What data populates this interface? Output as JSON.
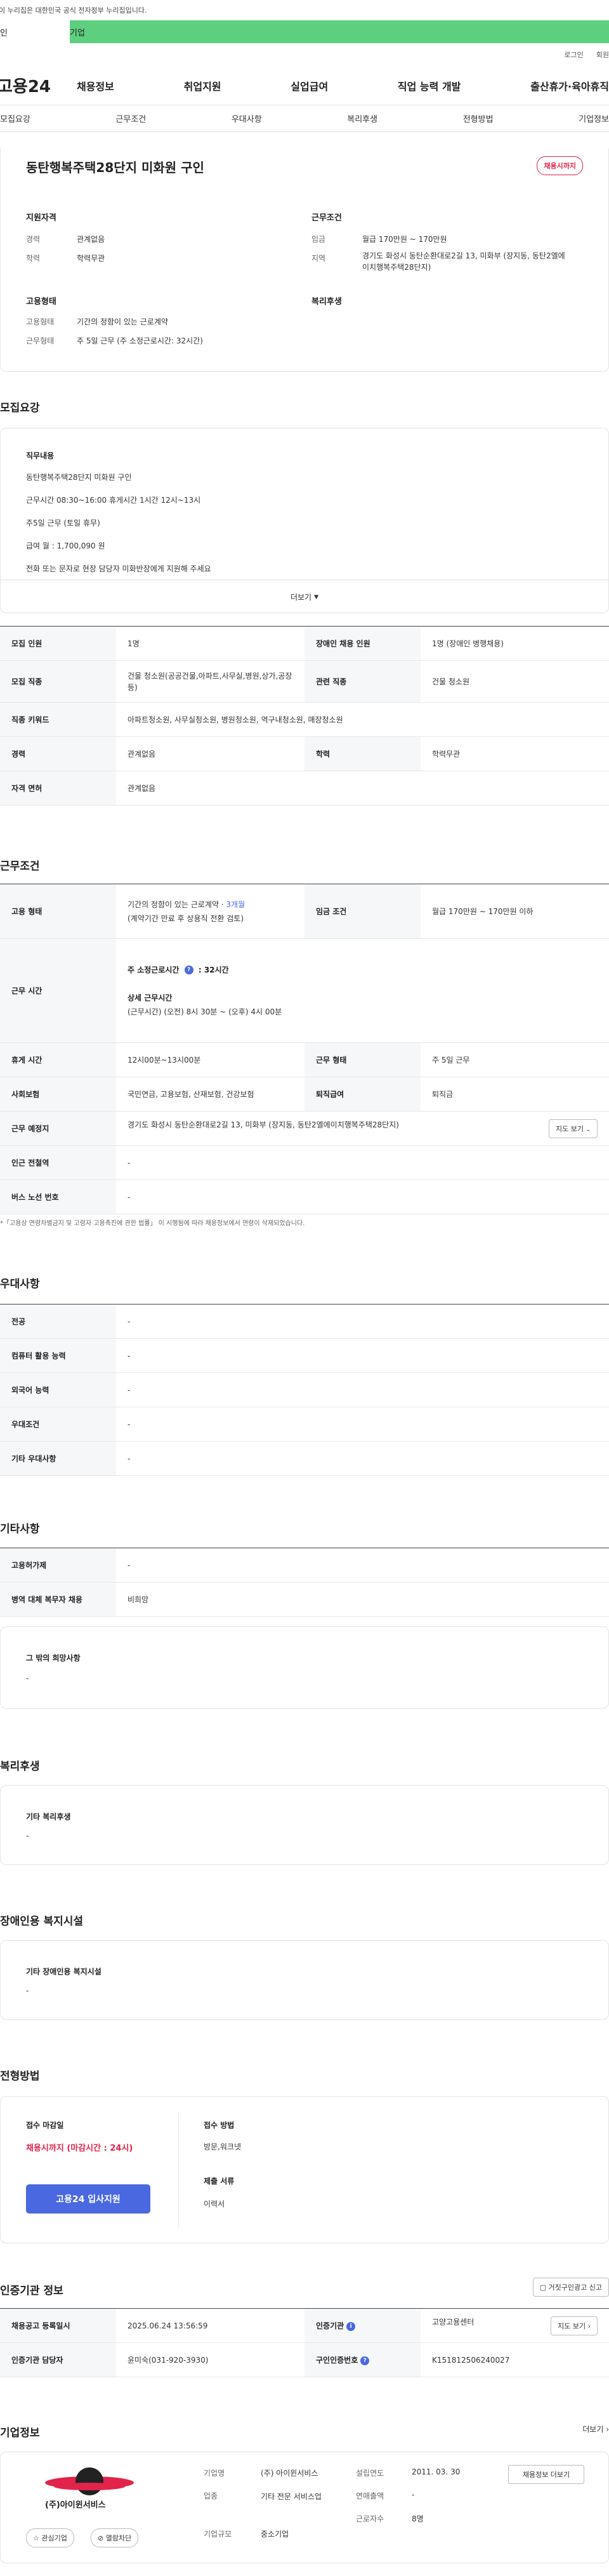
{
  "gov_banner": "이 누리집은 대한민국 공식 전자정부 누리집입니다.",
  "green_bar": {
    "left": "인",
    "right": "기업"
  },
  "utility": {
    "login": "로그인",
    "join": "회원"
  },
  "gnb": {
    "logo": "고용24",
    "menu": [
      "채용정보",
      "취업지원",
      "실업급여",
      "직업 능력 개발",
      "출산휴가·육아휴직"
    ]
  },
  "tabs": [
    "모집요강",
    "근무조건",
    "우대사항",
    "복리후생",
    "전형방법",
    "기업정보"
  ],
  "top": {
    "title": "동탄행복주택28단지 미화원 구인",
    "badge": "채용시까지",
    "qual_title": "지원자격",
    "career_label": "경력",
    "career_value": "관계없음",
    "edu_label": "학력",
    "edu_value": "학력무관",
    "work_title": "근무조건",
    "wage_label": "임금",
    "wage_value": "월급 170만원 ~ 170만원",
    "area_label": "지역",
    "area_value": "경기도 화성시 동탄순환대로2길 13, 미화부 (장지동, 동탄2엘에이치행복주택28단지)",
    "emp_title": "고용형태",
    "emptype_label": "고용형태",
    "emptype_value": "기간의 정함이 있는 근로계약",
    "worktype_label": "근무형태",
    "worktype_value": "주 5일 근무 (주 소정근로시간: 32시간)",
    "welfare_title": "복리후생"
  },
  "recruit": {
    "section_title": "모집요강",
    "duty_title": "직무내용",
    "duty_lines": [
      "동탄행복주택28단지 미화원 구인",
      "근무시간 08:30~16:00 휴게시간 1시간 12시~13시",
      "주5일 근무 (토일 휴무)",
      "급여 월 : 1,700,090 원",
      "전화 또는 문자로 현장 담당자 미화반장에게  지원해 주세요"
    ],
    "more": "더보기",
    "rows": [
      [
        "모집 인원",
        "1명",
        "장애인 채용 인원",
        "1명 (장애인 병행채용)"
      ],
      [
        "모집 직종",
        "건물 청소원(공공건물,아파트,사무실,병원,상가,공장 등)",
        "관련 직종",
        "건물 청소원"
      ],
      [
        "직종 키워드",
        "아파트청소원, 사무실청소원, 병원청소원, 역구내청소원, 매장청소원",
        "",
        ""
      ],
      [
        "경력",
        "관계없음",
        "학력",
        "학력무관"
      ],
      [
        "자격 면허",
        "관계없음",
        "",
        ""
      ]
    ]
  },
  "conditions": {
    "section_title": "근무조건",
    "emp_type_label": "고용 형태",
    "emp_type_value": "기간의 정함이 있는 근로계약 ·",
    "emp_type_period": "3개월",
    "emp_type_note": "(계약기간 만료 후 상용직 전환 검토)",
    "wage_label": "임금 조건",
    "wage_value": "월급 170만원 ~ 170만원 이하",
    "hours_label": "근무 시간",
    "hours_week": "주 소정근로시간",
    "hours_week_value": ": 32시간",
    "hours_detail_title": "상세 근무시간",
    "hours_detail": "(근무시간) (오전) 8시 30분 ~ (오후) 4시 00분",
    "rest_label": "휴게 시간",
    "rest_value": "12시00분~13시00분",
    "form_label": "근무 형태",
    "form_value": "주 5일 근무",
    "ins_label": "사회보험",
    "ins_value": "국민연금, 고용보험, 산재보험, 건강보험",
    "sev_label": "퇴직급여",
    "sev_value": "퇴직금",
    "place_label": "근무 예정지",
    "place_value": "경기도 화성시 동탄순환대로2길 13, 미화부 (장지동, 동탄2엘에이치행복주택28단지)",
    "map_btn": "지도 보기",
    "subway_label": "인근 전철역",
    "subway_value": "-",
    "bus_label": "버스 노선 번호",
    "bus_value": "-",
    "notice": "*「고용상 연령차별금지 및 고령자 고용촉진에 관한 법률」 이 시행됨에 따라 채용정보에서 연령이 삭제되었습니다."
  },
  "pref": {
    "section_title": "우대사항",
    "rows": [
      [
        "전공",
        "-"
      ],
      [
        "컴퓨터 활용 능력",
        "-"
      ],
      [
        "외국어 능력",
        "-"
      ],
      [
        "우대조건",
        "-"
      ],
      [
        "기타 우대사항",
        "-"
      ]
    ]
  },
  "etc": {
    "section_title": "기타사항",
    "rows": [
      [
        "고용허가제",
        "-"
      ],
      [
        "병역 대체 복무자 채용",
        "비희망"
      ]
    ],
    "other_title": "그 밖의 희망사항",
    "other_value": "-"
  },
  "welfare": {
    "section_title": "복리후생",
    "box_title": "기타 복리후생",
    "box_value": "-"
  },
  "disability": {
    "section_title": "장애인용 복지시설",
    "box_title": "기타 장애인용 복지시설",
    "box_value": "-"
  },
  "selection": {
    "section_title": "전형방법",
    "deadline_title": "접수 마감일",
    "deadline_value": "채용시까지 (마감시간 : 24시)",
    "apply_btn": "고용24 입사지원",
    "method_title": "접수 방법",
    "method_value": "방문,워크넷",
    "docs_title": "제출 서류",
    "docs_value": "이력서"
  },
  "cert": {
    "section_title": "인증기관 정보",
    "report_btn": "거짓구인광고 신고",
    "reg_label": "채용공고 등록일시",
    "reg_value": "2025.06.24 13:56:59",
    "org_label": "인증기관",
    "org_value": "고양고용센터",
    "map_btn": "지도 보기",
    "mgr_label": "인증기관 담당자",
    "mgr_value": "윤미숙(031-920-3930)",
    "num_label": "구인인증번호",
    "num_value": "K151812506240027"
  },
  "company": {
    "section_title": "기업정보",
    "more": "더보기",
    "logo_text": "(주)아이윈서비스",
    "fav_btn": "관심기업",
    "block_btn": "열람차단",
    "name_label": "기업명",
    "name_value": "(주) 아이윈서비스",
    "industry_label": "업종",
    "industry_value": "기타 전문 서비스업",
    "size_label": "기업규모",
    "size_value": "중소기업",
    "founded_label": "설립연도",
    "founded_value": "2011. 03. 30",
    "revenue_label": "연매출액",
    "revenue_value": "-",
    "staff_label": "근로자수",
    "staff_value": "8명",
    "jobs_btn": "채용정보 더보기"
  },
  "colors": {
    "green": "#5ecf7e",
    "red": "#e2234b",
    "blue": "#4a68e0"
  }
}
